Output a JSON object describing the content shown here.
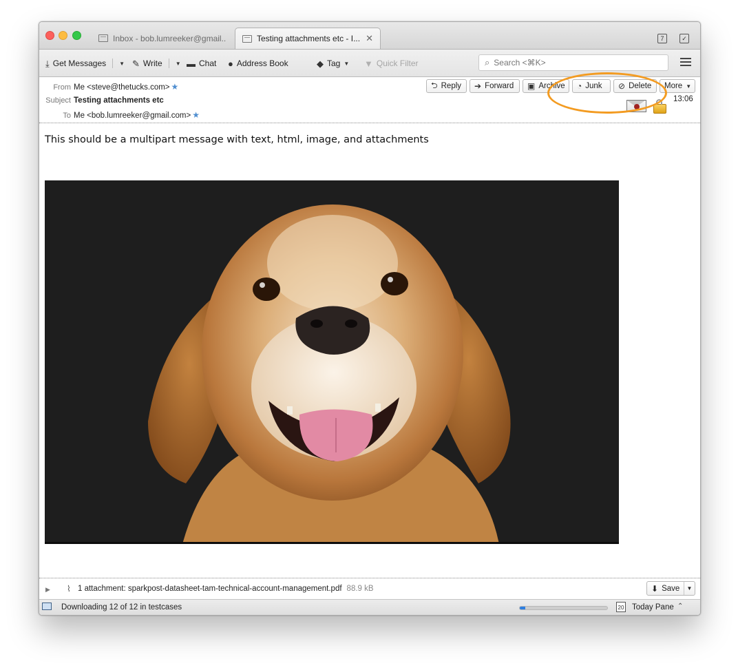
{
  "tabs": [
    {
      "label": "Inbox - bob.lumreeker@gmail....",
      "active": false
    },
    {
      "label": "Testing attachments etc - I...",
      "active": true
    }
  ],
  "titlebar": {
    "calendar_icon_text": "7",
    "tasks_icon_text": "✓"
  },
  "toolbar": {
    "get_messages": "Get Messages",
    "write": "Write",
    "chat": "Chat",
    "address_book": "Address Book",
    "tag": "Tag",
    "quick_filter": "Quick Filter",
    "search_placeholder": "Search <⌘K>"
  },
  "header": {
    "from_label": "From",
    "from_value": "Me <steve@thetucks.com>",
    "subject_label": "Subject",
    "subject_value": "Testing attachments etc",
    "to_label": "To",
    "to_value": "Me <bob.lumreeker@gmail.com>",
    "time": "13:06",
    "buttons": {
      "reply": "Reply",
      "forward": "Forward",
      "archive": "Archive",
      "junk": "Junk",
      "delete": "Delete",
      "more": "More"
    }
  },
  "body": {
    "text": "This should be a multipart message with text, html, image, and attachments"
  },
  "attachment": {
    "text": "1 attachment: sparkpost-datasheet-tam-technical-account-management.pdf",
    "size": "88.9 kB",
    "save_label": "Save"
  },
  "status": {
    "text": "Downloading 12 of 12 in testcases",
    "progress": 0.06,
    "today_pane": "Today Pane",
    "today_icon_text": "20"
  },
  "colors": {
    "highlight_ring": "#f39b21",
    "progress_fill": "#2f7fe0",
    "star": "#4f8ed0"
  }
}
